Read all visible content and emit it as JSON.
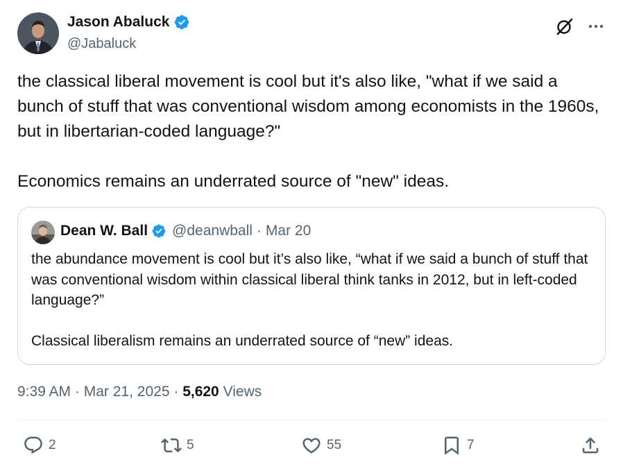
{
  "author": {
    "name": "Jason Abaluck",
    "handle": "@Jabaluck"
  },
  "tweet": {
    "paragraph1": "the classical liberal movement is cool but it's also like, \"what if we said a bunch of stuff that was conventional wisdom among economists in the 1960s, but in libertarian-coded language?\"",
    "paragraph2": "Economics remains an underrated source of \"new\" ideas."
  },
  "quote": {
    "name": "Dean W. Ball",
    "handle": "@deanwball",
    "separator": "·",
    "date": "Mar 20",
    "paragraph1": "the abundance movement is cool but it’s also like, “what if we said a bunch of stuff that was conventional wisdom within classical liberal think tanks in 2012, but in left-coded language?”",
    "paragraph2": "Classical liberalism remains an underrated source of “new” ideas."
  },
  "meta": {
    "time": "9:39 AM",
    "sep1": "·",
    "date": "Mar 21, 2025",
    "sep2": "·",
    "views_count": "5,620",
    "views_label": "Views"
  },
  "actions": {
    "replies": "2",
    "reposts": "5",
    "likes": "55",
    "bookmarks": "7"
  },
  "icons": {
    "verified": "verified-badge-icon",
    "grok": "grok-icon",
    "more": "more-icon",
    "reply": "reply-icon",
    "repost": "repost-icon",
    "like": "like-icon",
    "bookmark": "bookmark-icon",
    "share": "share-icon"
  },
  "colors": {
    "text": "#0f1419",
    "secondary": "#536471",
    "verified": "#1d9bf0",
    "border": "#cfd9de"
  }
}
